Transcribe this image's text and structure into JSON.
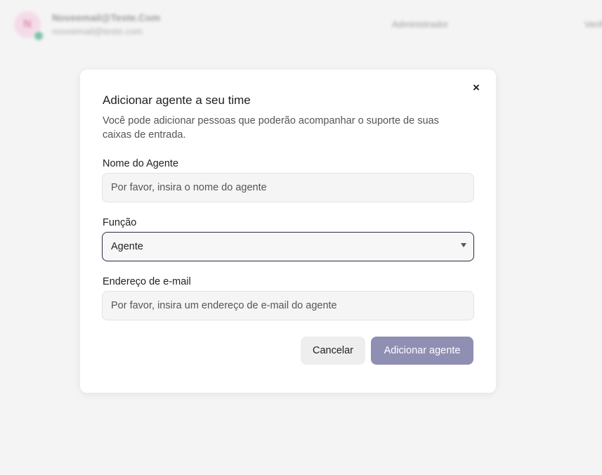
{
  "background": {
    "avatar_initial": "N",
    "user_name": "Noveemail@Teste.Com",
    "user_email": "novoemail@teste.com",
    "role": "Administrador",
    "verify": "Verificado"
  },
  "modal": {
    "title": "Adicionar agente a seu time",
    "description": "Você pode adicionar pessoas que poderão acompanhar o suporte de suas caixas de entrada.",
    "close_icon": "×",
    "name_field": {
      "label": "Nome do Agente",
      "value": "",
      "placeholder": "Por favor, insira o nome do agente"
    },
    "role_field": {
      "label": "Função",
      "selected": "Agente"
    },
    "email_field": {
      "label": "Endereço de e-mail",
      "value": "",
      "placeholder": "Por favor, insira um endereço de e-mail do agente"
    },
    "cancel_label": "Cancelar",
    "submit_label": "Adicionar agente"
  },
  "colors": {
    "primary_disabled": "#8f8fb3",
    "select_border": "#2b2b44",
    "avatar_bg": "#f6c7df",
    "status_online": "#1c9c68"
  }
}
